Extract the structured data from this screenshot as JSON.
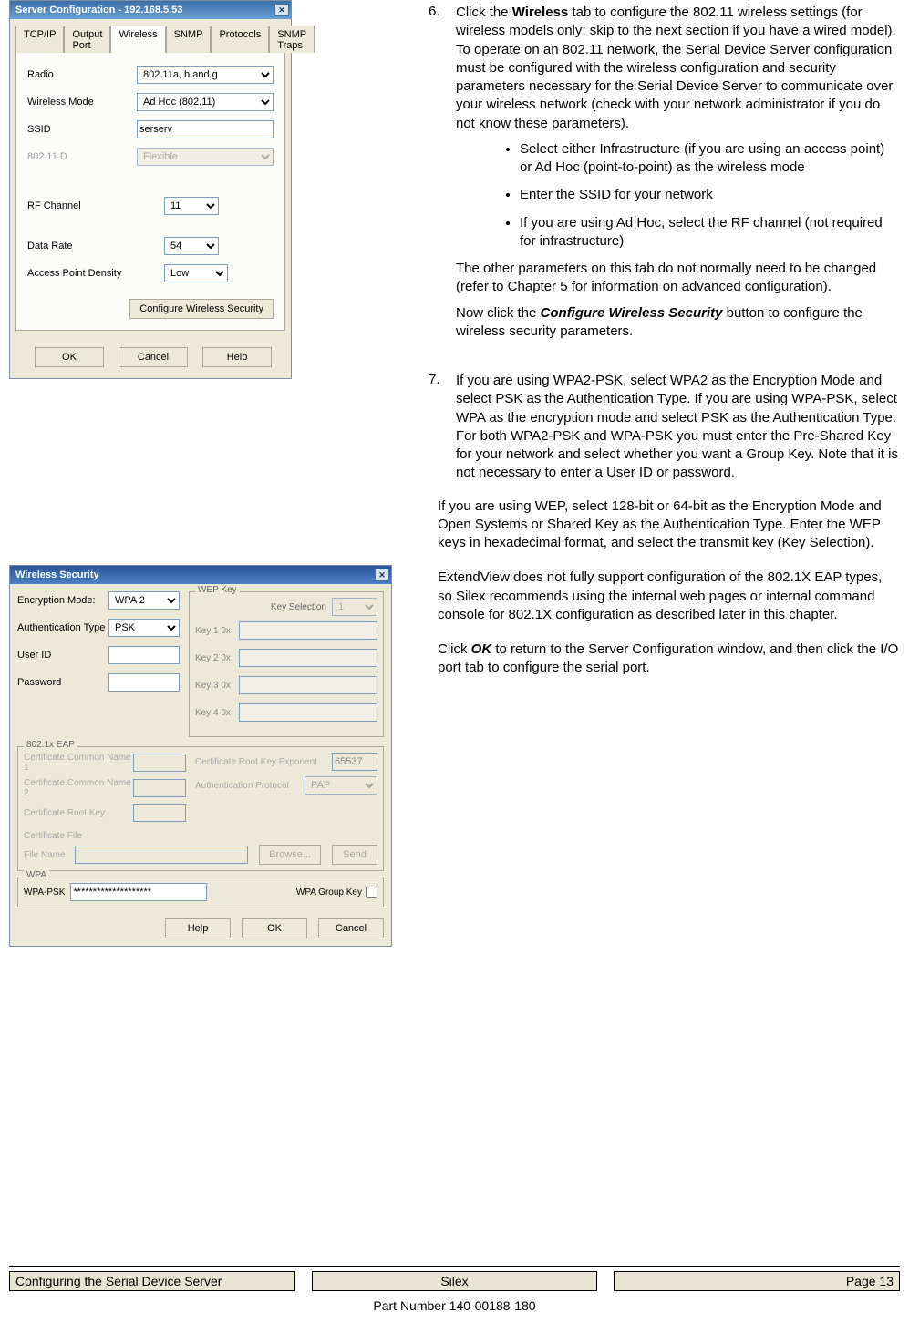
{
  "dialog1": {
    "title": "Server Configuration - 192.168.5.53",
    "tabs": [
      "TCP/IP",
      "Output Port",
      "Wireless",
      "SNMP",
      "Protocols",
      "SNMP Traps"
    ],
    "active_tab": "Wireless",
    "fields": {
      "radio_label": "Radio",
      "radio_value": "802.11a, b and g",
      "mode_label": "Wireless Mode",
      "mode_value": "Ad Hoc (802.11)",
      "ssid_label": "SSID",
      "ssid_value": "serserv",
      "d80211_label": "802.11 D",
      "d80211_value": "Flexible",
      "rfchan_label": "RF Channel",
      "rfchan_value": "11",
      "rate_label": "Data Rate",
      "rate_value": "54",
      "density_label": "Access Point Density",
      "density_value": "Low",
      "cfg_wsec_btn": "Configure Wireless Security"
    },
    "buttons": {
      "ok": "OK",
      "cancel": "Cancel",
      "help": "Help"
    }
  },
  "dialog2": {
    "title": "Wireless Security",
    "left": {
      "enc_label": "Encryption Mode:",
      "enc_value": "WPA 2",
      "auth_label": "Authentication Type",
      "auth_value": "PSK",
      "userid_label": "User ID",
      "userid_value": "",
      "pwd_label": "Password",
      "pwd_value": ""
    },
    "wepkey": {
      "legend": "WEP Key",
      "keysel_label": "Key Selection",
      "keysel_value": "1",
      "k1": "Key 1   0x",
      "k2": "Key 2   0x",
      "k3": "Key 3   0x",
      "k4": "Key 4   0x"
    },
    "eap": {
      "legend": "802.1x EAP",
      "cn1": "Certificate Common Name 1",
      "cn2": "Certificate Common Name 2",
      "rootkey": "Certificate Root Key",
      "certfile": "Certificate File",
      "filename": "File Name",
      "exp_label": "Certificate Root Key Exponent",
      "exp_value": "65537",
      "authp_label": "Authentication Protocol",
      "authp_value": "PAP",
      "browse": "Browse...",
      "send": "Send"
    },
    "wpa": {
      "legend": "WPA",
      "psk_label": "WPA-PSK",
      "psk_value": "********************",
      "gk_label": "WPA Group Key"
    },
    "buttons": {
      "help": "Help",
      "ok": "OK",
      "cancel": "Cancel"
    }
  },
  "steps": {
    "s6": {
      "num": "6.",
      "intro": "Click the <b>Wireless</b> tab to configure the 802.11 wireless settings (for wireless models only; skip to the next section if you have a wired model).  To operate on an 802.11 network, the Serial Device Server configuration must be configured with the wireless configuration and security parameters necessary for the Serial Device Server to communicate over your wireless network (check with your network administrator if you do not know these parameters).",
      "bullets": [
        "Select either Infrastructure (if you are using an access point) or Ad Hoc (point-to-point) as the wireless mode",
        "Enter the SSID for your network",
        "If you are using Ad Hoc, select the RF channel (not required for infrastructure)"
      ],
      "after1": "The other parameters on this tab do not normally need to be changed (refer to Chapter 5 for information on advanced configuration).",
      "after2": "Now click the <b><i>Configure Wireless Security</i></b> button to configure the wireless security parameters."
    },
    "s7": {
      "num": "7.",
      "p1": "If you are using WPA2-PSK, select WPA2 as the Encryption Mode and select PSK as the Authentication Type.  If you are using WPA-PSK, select WPA as the encryption mode and select PSK as the Authentication Type.  For both WPA2-PSK and WPA-PSK you must enter the Pre-Shared Key for your network and select whether you want a Group Key.  Note that it is not necessary to enter a User ID or password.",
      "p2": "If you are using WEP, select 128-bit or 64-bit as the Encryption Mode and Open Systems or Shared Key as the Authentication Type.  Enter the WEP keys in hexadecimal format, and select the transmit key (Key Selection).",
      "p3": "ExtendView does not fully support configuration of the 802.1X EAP types, so Silex recommends using the internal web pages or internal command console for 802.1X configuration as described later in this chapter.",
      "p4": "Click <b><i>OK</i></b> to return to the Server Configuration window, and then click the I/O port tab to configure the serial port."
    }
  },
  "footer": {
    "left": "Configuring the Serial Device Server",
    "center": "Silex",
    "right": "Page 13",
    "part": "Part Number 140-00188-180"
  }
}
